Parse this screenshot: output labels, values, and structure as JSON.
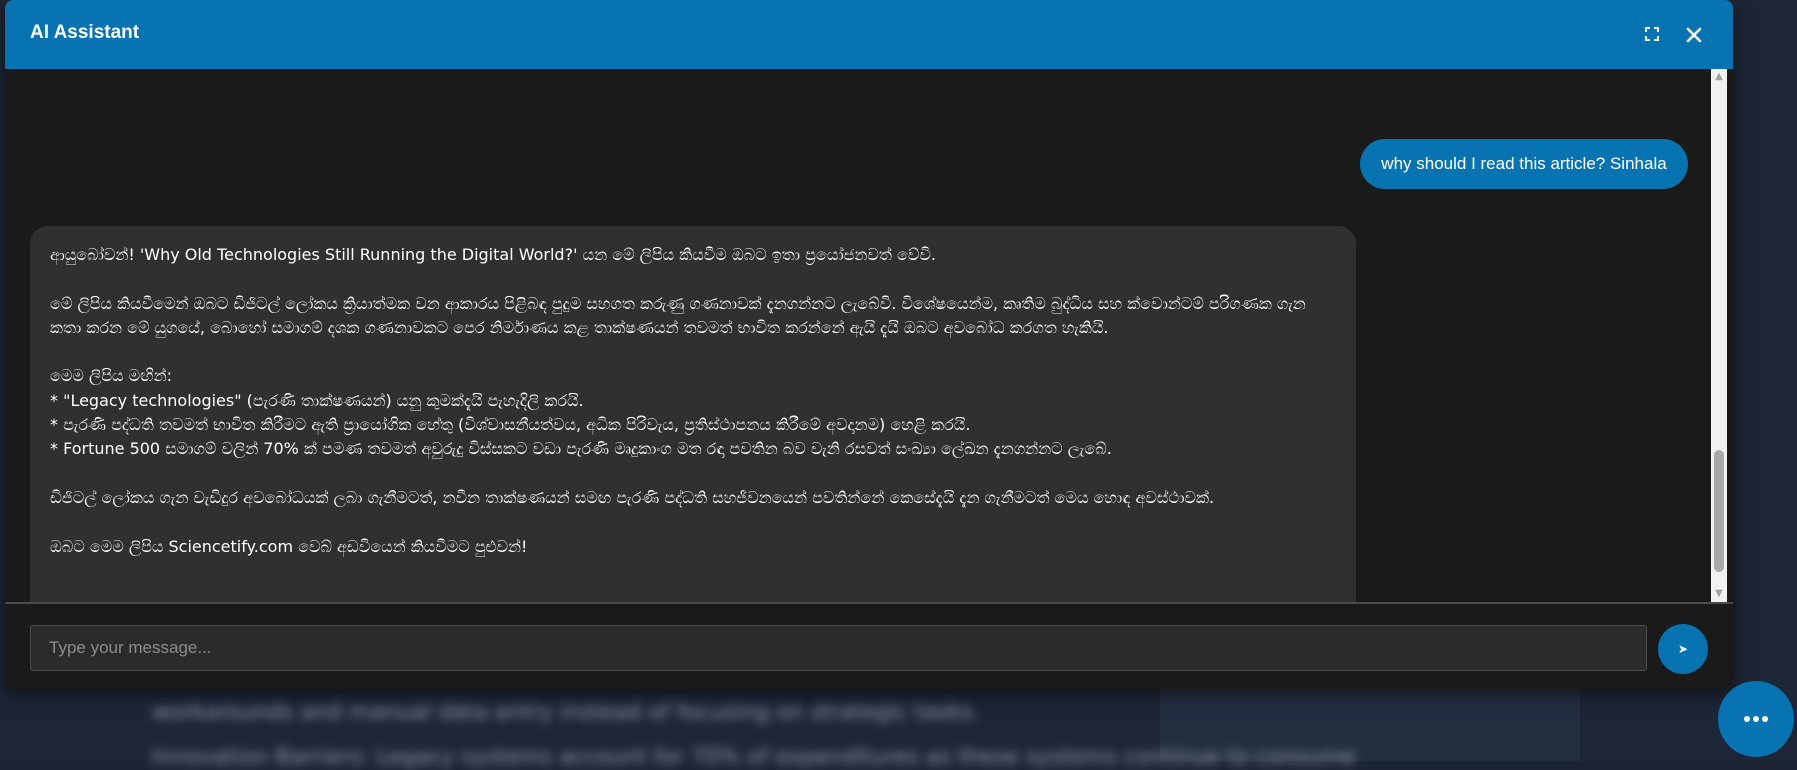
{
  "window": {
    "title": "AI Assistant"
  },
  "icons": {
    "expand": "expand-icon",
    "close": "close-icon",
    "send": "send-icon",
    "chat_fab": "more-dots-icon"
  },
  "colors": {
    "accent": "#0773b0",
    "window_bg": "#1a1a1a",
    "assistant_bubble": "#303030"
  },
  "messages": {
    "user": "why should I read this article? Sinhala",
    "assistant": {
      "p1": "ආයුබෝවන්! 'Why Old Technologies Still Running the Digital World?' යන මේ ලිපිය කියවීම ඔබට ඉතා ප්‍රයෝජනවත් වේවි.",
      "p2": "මේ ලිපිය කියවීමෙන් ඔබට ඩිජිටල් ලෝකය ක්‍රියාත්මක වන ආකාරය පිළිබඳ පුදුම සහගත කරුණු ගණනාවක් දැනගන්නට ලැබේවි. විශේෂයෙන්ම, කෘතිම බුද්ධිය සහ ක්වොන්ටම් පරිගණක ගැන කතා කරන මේ යුගයේ, බොහෝ සමාගම් දශක ගණනාවකට පෙර නිර්මාණය කළ තාක්ෂණයන් තවමත් භාවිත කරන්නේ ඇයි දැයි ඔබට අවබෝධ කරගත හැකියි.",
      "p3_intro": "මෙම ලිපිය මඟින්:",
      "p3_b1": "* \"Legacy technologies\" (පැරණි තාක්ෂණයන්) යනු කුමක්දැයි පැහැදිලි කරයි.",
      "p3_b2": "* පැරණි පද්ධති තවමත් භාවිත කිරීමට ඇති ප්‍රායෝගික හේතු (විශ්වාසනීයත්වය, අධික පිරිවැය, ප්‍රතිස්ථාපනය කිරීමේ අවදානම) හෙළි කරයි.",
      "p3_b3": "* Fortune 500 සමාගම් වලින් 70% ක් පමණ තවමත් අවුරුදු විස්සකට වඩා පැරණි මෘදුකාංග මත රඳා පවතින බව වැනි රසවත් සංඛ්‍යා ලේඛන දැනගන්නට ලැබේ.",
      "p4": "ඩිජිටල් ලෝකය ගැන වැඩිදුර අවබෝධයක් ලබා ගැනීමටත්, නවීන තාක්ෂණයන් සමඟ පැරණි පද්ධති සහජීවනයෙන් පවතින්නේ කෙසේදැයි දැන ගැනීමටත් මෙය හොඳ අවස්ථාවක්.",
      "p5": "ඔබට මෙම ලිපිය Sciencetify.com වෙබ් අඩවියෙන් කියවීමට පුළුවන්!"
    }
  },
  "input": {
    "placeholder": "Type your message...",
    "value": "",
    "send_label": "➤"
  },
  "scrollbar": {
    "up_arrow": "▲",
    "down_arrow": "▼"
  },
  "background_page": {
    "line1": "workarounds and manual data entry instead of focusing on strategic tasks.",
    "line2": "Innovation Barriers: Legacy systems account for 70% of expenditures as these systems continue to consume"
  }
}
